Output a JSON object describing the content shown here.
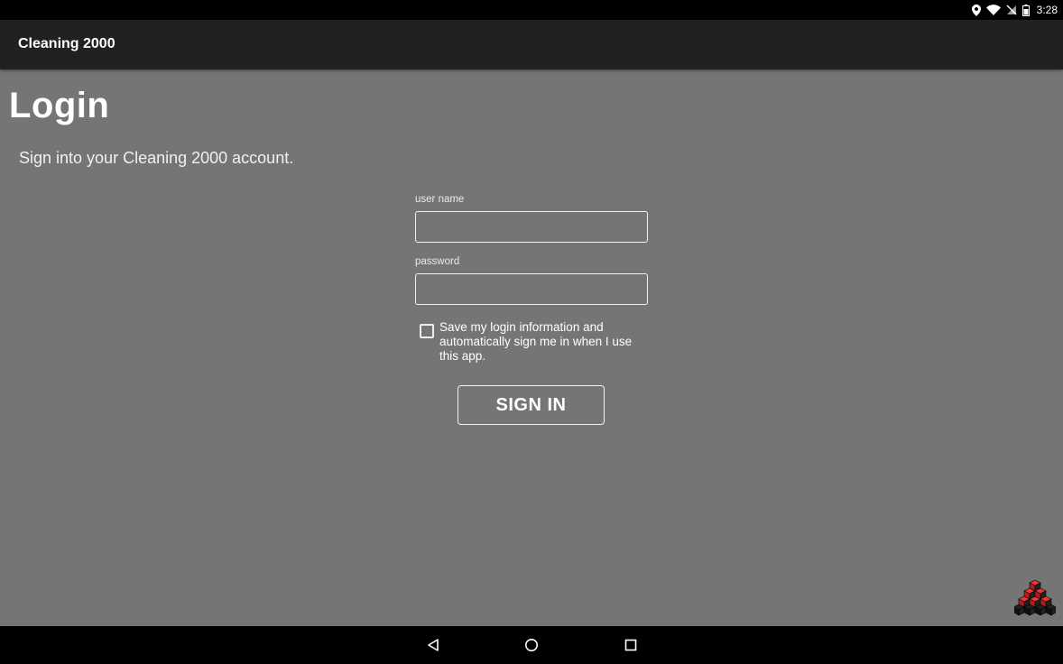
{
  "status_bar": {
    "icons": [
      "location-icon",
      "wifi-icon",
      "no-sim-icon",
      "battery-icon"
    ],
    "time": "3:28"
  },
  "app_bar": {
    "title": "Cleaning 2000"
  },
  "login": {
    "title": "Login",
    "subtitle": "Sign into your Cleaning 2000 account.",
    "username": {
      "label": "user name",
      "value": "",
      "placeholder": ""
    },
    "password": {
      "label": "password",
      "value": "",
      "placeholder": ""
    },
    "remember": {
      "label": "Save my login information and automatically sign me in when I use this app.",
      "checked": false
    },
    "sign_in_label": "SIGN IN"
  },
  "nav_bar": {
    "buttons": [
      "back-icon",
      "home-icon",
      "recents-icon"
    ]
  },
  "colors": {
    "background": "#757575",
    "app_bar": "#212121",
    "status_bar": "#000000",
    "logo_red": "#d32f2f"
  }
}
